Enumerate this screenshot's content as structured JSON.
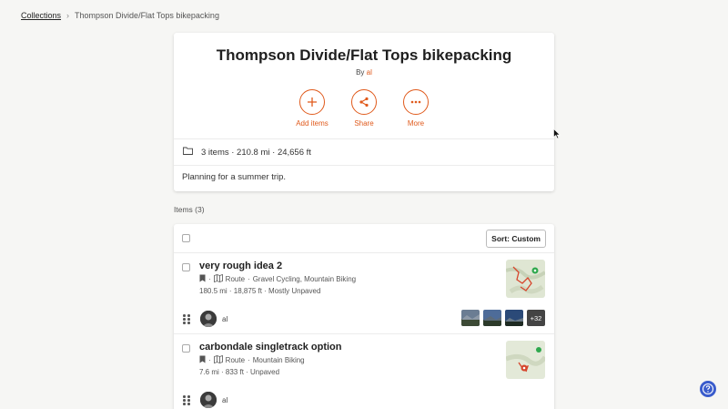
{
  "breadcrumb": {
    "root": "Collections",
    "separator": "›",
    "current": "Thompson Divide/Flat Tops bikepacking"
  },
  "collection": {
    "title": "Thompson Divide/Flat Tops bikepacking",
    "by_prefix": "By",
    "author": "al",
    "actions": [
      {
        "label": "Add items",
        "icon": "plus-icon"
      },
      {
        "label": "Share",
        "icon": "share-icon"
      },
      {
        "label": "More",
        "icon": "ellipsis-icon"
      }
    ],
    "stats": "3 items · 210.8 mi · 24,656 ft",
    "description": "Planning for a summer trip."
  },
  "items_header": "Items (3)",
  "toolbar": {
    "sort_label": "Sort: Custom"
  },
  "items": [
    {
      "title": "very rough idea 2",
      "type": "Route",
      "activities": "Gravel Cycling, Mountain Biking",
      "stats": "180.5 mi · 18,875 ft · Mostly Unpaved",
      "owner": "al",
      "extra_photos": "+32"
    },
    {
      "title": "carbondale singletrack option",
      "type": "Route",
      "activities": "Mountain Biking",
      "stats": "7.6 mi · 833 ft · Unpaved",
      "owner": "al"
    }
  ],
  "colors": {
    "accent": "#e05a1c",
    "help": "#3a5ccc"
  }
}
